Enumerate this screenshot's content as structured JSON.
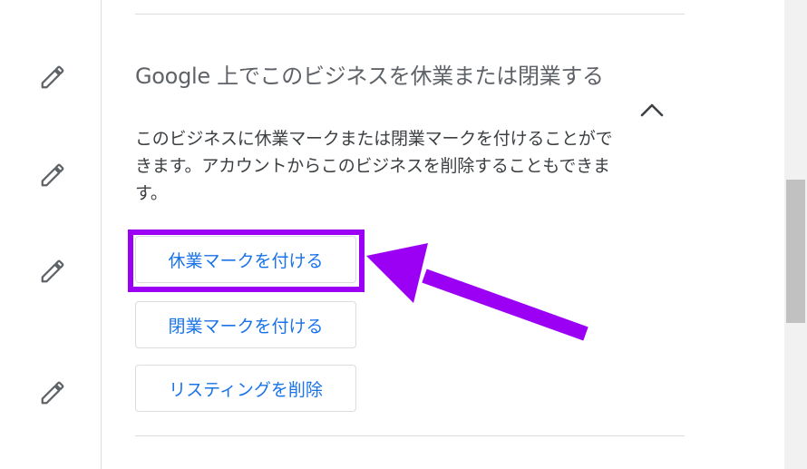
{
  "section": {
    "title": "Google 上でこのビジネスを休業または閉業する",
    "description": "このビジネスに休業マークまたは閉業マークを付けることができます。アカウントからこのビジネスを削除することもできます。"
  },
  "buttons": {
    "temporarily_closed": "休業マークを付ける",
    "permanently_closed": "閉業マークを付ける",
    "remove_listing": "リスティングを削除"
  },
  "icons": {
    "edit": "pencil-icon",
    "collapse": "chevron-up-icon"
  },
  "colors": {
    "accent_blue": "#1a73e8",
    "highlight_purple": "#9b00f5",
    "title_gray": "#5f6368",
    "text": "#3c4043",
    "border": "#dadce0"
  }
}
